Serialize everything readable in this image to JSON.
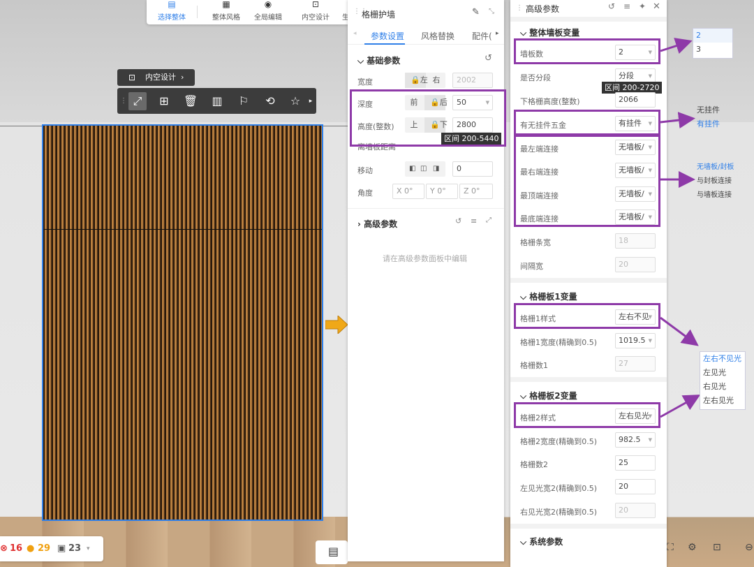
{
  "toolbar": {
    "items": [
      {
        "label": "选择整体",
        "icon": "select-icon"
      },
      {
        "label": "整体风格",
        "icon": "style-icon"
      },
      {
        "label": "全局编辑",
        "icon": "global-edit-icon"
      },
      {
        "label": "内空设计",
        "icon": "inner-design-icon"
      },
      {
        "label": "生"
      }
    ]
  },
  "chip": {
    "label": "内空设计"
  },
  "status": {
    "errors": "16",
    "warnings": "29",
    "items": "23"
  },
  "panel": {
    "title": "格栅护墙",
    "tabs": [
      "参数设置",
      "风格替换",
      "配件("
    ],
    "basic": {
      "title": "基础参数",
      "width": {
        "label": "宽度",
        "opt1": "左",
        "opt2": "右",
        "value": "2002"
      },
      "depth": {
        "label": "深度",
        "opt1": "前",
        "opt2": "后",
        "value": "50"
      },
      "height": {
        "label": "高度(整数)",
        "opt1": "上",
        "opt2": "下",
        "value": "2800",
        "tip": "区间 200-5440"
      },
      "dist": {
        "label": "离墙板距离"
      },
      "move": {
        "label": "移动",
        "value": "0"
      },
      "angle": {
        "label": "角度",
        "x": "X 0°",
        "y": "Y 0°",
        "z": "Z 0°"
      }
    },
    "advanced": {
      "title": "高级参数",
      "hint": "请在高级参数面板中编辑"
    }
  },
  "rpanel": {
    "title": "高级参数",
    "sec1": {
      "title": "整体墙板变量",
      "rows": [
        {
          "label": "墙板数",
          "value": "2"
        },
        {
          "label": "是否分段",
          "value": "分段"
        },
        {
          "label": "下格栅高度(整数)",
          "value": "2066"
        },
        {
          "label": "有无挂件五金",
          "value": "有挂件"
        },
        {
          "label": "最左端连接",
          "value": "无墙板/"
        },
        {
          "label": "最右端连接",
          "value": "无墙板/"
        },
        {
          "label": "最顶端连接",
          "value": "无墙板/"
        },
        {
          "label": "最底端连接",
          "value": "无墙板/"
        },
        {
          "label": "格栅条宽",
          "value": "18"
        },
        {
          "label": "间隔宽",
          "value": "20"
        }
      ],
      "tip": "区间 200-2720"
    },
    "sec2": {
      "title": "格栅板1变量",
      "rows": [
        {
          "label": "格栅1样式",
          "value": "左右不见"
        },
        {
          "label": "格栅1宽度(精确到0.5)",
          "value": "1019.5"
        },
        {
          "label": "格栅数1",
          "value": "27"
        }
      ]
    },
    "sec3": {
      "title": "格栅板2变量",
      "rows": [
        {
          "label": "格栅2样式",
          "value": "左右见光"
        },
        {
          "label": "格栅2宽度(精确到0.5)",
          "value": "982.5"
        },
        {
          "label": "格栅数2",
          "value": "25"
        },
        {
          "label": "左见光宽2(精确到0.5)",
          "value": "20"
        },
        {
          "label": "右见光宽2(精确到0.5)",
          "value": "20"
        }
      ]
    },
    "sec4": {
      "title": "系统参数"
    }
  },
  "popups": {
    "panelcount": [
      "2",
      "3"
    ],
    "hanger": [
      "无挂件",
      "有挂件"
    ],
    "connect": [
      "无墙板/封板",
      "与封板连接",
      "与墙板连接"
    ],
    "style1": [
      "左右不见光",
      "左见光",
      "右见光",
      "左右见光"
    ]
  },
  "colors": {
    "accent": "#2f7fe8",
    "highlight": "#8e3aa8",
    "arrow": "#f0a818"
  }
}
